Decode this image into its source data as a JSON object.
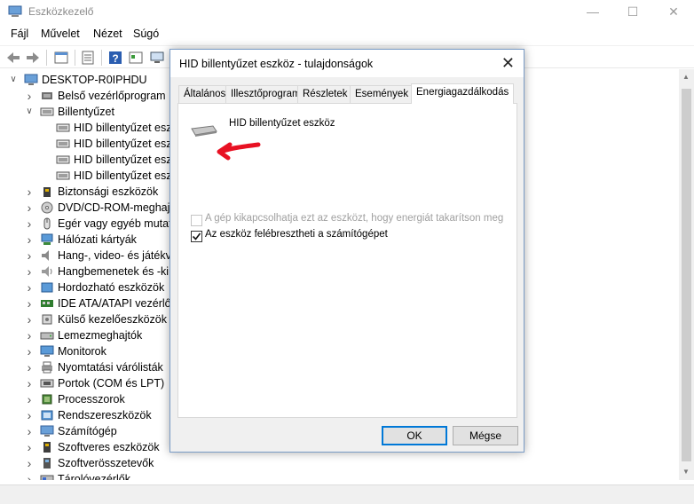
{
  "window": {
    "title": "Eszközkezelő",
    "controls": [
      "minimize",
      "maximize",
      "close"
    ]
  },
  "menu": [
    "Fájl",
    "Művelet",
    "Nézet",
    "Súgó"
  ],
  "tree": {
    "root": "DESKTOP-R0IPHDU",
    "items": [
      {
        "label": "Belső vezérlőprogram",
        "level": 1,
        "expanded": false,
        "icon": "firmware-icon"
      },
      {
        "label": "Billentyűzet",
        "level": 1,
        "expanded": true,
        "icon": "keyboard-icon"
      },
      {
        "label": "HID billentyűzet eszköz",
        "level": 2,
        "icon": "keyboard-icon"
      },
      {
        "label": "HID billentyűzet eszköz",
        "level": 2,
        "icon": "keyboard-icon"
      },
      {
        "label": "HID billentyűzet eszköz",
        "level": 2,
        "icon": "keyboard-icon"
      },
      {
        "label": "HID billentyűzet eszköz",
        "level": 2,
        "icon": "keyboard-icon"
      },
      {
        "label": "Biztonsági eszközök",
        "level": 1,
        "expanded": false,
        "icon": "security-device-icon"
      },
      {
        "label": "DVD/CD-ROM-meghajtók",
        "level": 1,
        "expanded": false,
        "icon": "dvd-icon"
      },
      {
        "label": "Egér vagy egyéb mutatóeszköz",
        "level": 1,
        "expanded": false,
        "icon": "mouse-icon"
      },
      {
        "label": "Hálózati kártyák",
        "level": 1,
        "expanded": false,
        "icon": "network-icon"
      },
      {
        "label": "Hang-, video- és játékvezérlők",
        "level": 1,
        "expanded": false,
        "icon": "audio-icon"
      },
      {
        "label": "Hangbemenetek és -kimenetek",
        "level": 1,
        "expanded": false,
        "icon": "speaker-icon"
      },
      {
        "label": "Hordozható eszközök",
        "level": 1,
        "expanded": false,
        "icon": "portable-device-icon"
      },
      {
        "label": "IDE ATA/ATAPI vezérlők",
        "level": 1,
        "expanded": false,
        "icon": "ide-icon"
      },
      {
        "label": "Külső kezelőeszközök",
        "level": 1,
        "expanded": false,
        "icon": "hid-icon"
      },
      {
        "label": "Lemezmeghajtók",
        "level": 1,
        "expanded": false,
        "icon": "disk-icon"
      },
      {
        "label": "Monitorok",
        "level": 1,
        "expanded": false,
        "icon": "monitor-icon"
      },
      {
        "label": "Nyomtatási várólisták",
        "level": 1,
        "expanded": false,
        "icon": "printer-icon"
      },
      {
        "label": "Portok (COM és LPT)",
        "level": 1,
        "expanded": false,
        "icon": "port-icon"
      },
      {
        "label": "Processzorok",
        "level": 1,
        "expanded": false,
        "icon": "processor-icon"
      },
      {
        "label": "Rendszereszközök",
        "level": 1,
        "expanded": false,
        "icon": "system-device-icon"
      },
      {
        "label": "Számítógép",
        "level": 1,
        "expanded": false,
        "icon": "computer-icon"
      },
      {
        "label": "Szoftveres eszközök",
        "level": 1,
        "expanded": false,
        "icon": "software-device-icon"
      },
      {
        "label": "Szoftverösszetevők",
        "level": 1,
        "expanded": false,
        "icon": "software-component-icon"
      },
      {
        "label": "Tárolóvezérlők",
        "level": 1,
        "expanded": false,
        "icon": "storage-controller-icon"
      }
    ]
  },
  "dialog": {
    "title": "HID billentyűzet eszköz - tulajdonságok",
    "tabs": [
      "Általános",
      "Illesztőprogram",
      "Részletek",
      "Események",
      "Energiagazdálkodás"
    ],
    "active_tab": "Energiagazdálkodás",
    "device_name": "HID billentyűzet eszköz",
    "options": [
      {
        "label": "A gép kikapcsolhatja ezt az eszközt, hogy energiát takarítson meg",
        "checked": false,
        "disabled": true
      },
      {
        "label": "Az eszköz felébresztheti a számítógépet",
        "checked": true,
        "disabled": false
      }
    ],
    "ok_label": "OK",
    "cancel_label": "Mégse"
  },
  "colors": {
    "accent": "#0078d7",
    "annotation": "#e81123"
  }
}
